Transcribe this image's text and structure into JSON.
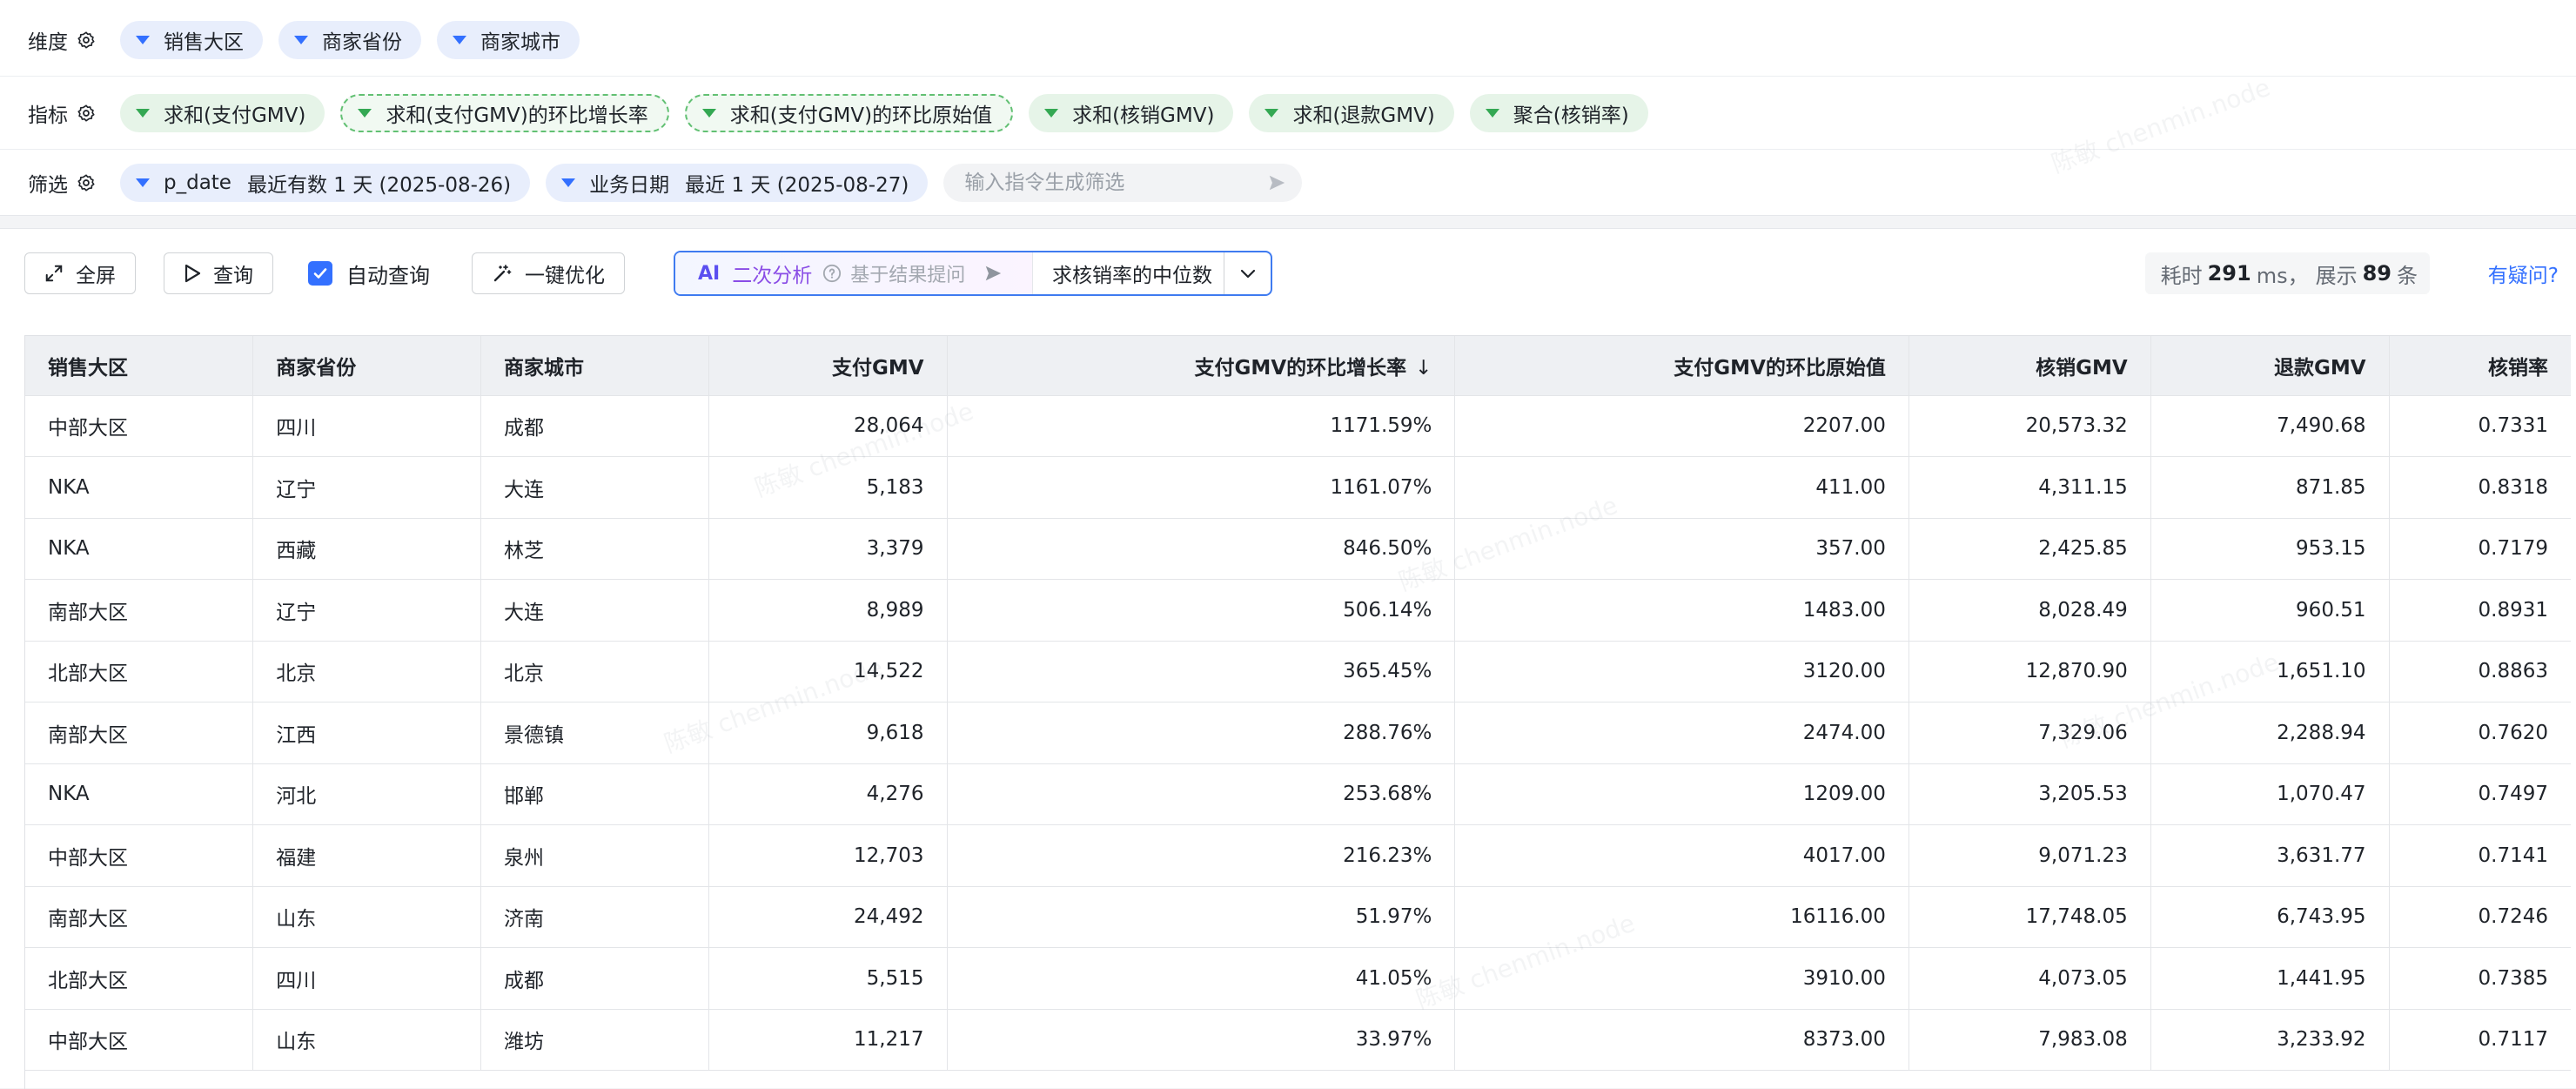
{
  "config": {
    "dimensions": {
      "label": "维度",
      "chips": [
        "销售大区",
        "商家省份",
        "商家城市"
      ]
    },
    "metrics": {
      "label": "指标",
      "chips": [
        {
          "label": "求和(支付GMV)",
          "dashed": false
        },
        {
          "label": "求和(支付GMV)的环比增长率",
          "dashed": true
        },
        {
          "label": "求和(支付GMV)的环比原始值",
          "dashed": true
        },
        {
          "label": "求和(核销GMV)",
          "dashed": false
        },
        {
          "label": "求和(退款GMV)",
          "dashed": false
        },
        {
          "label": "聚合(核销率)",
          "dashed": false
        }
      ]
    },
    "filters": {
      "label": "筛选",
      "chips": [
        {
          "field": "p_date",
          "value": "最近有数 1 天 (2025-08-26)"
        },
        {
          "field": "业务日期",
          "value": "最近 1 天 (2025-08-27)"
        }
      ],
      "command_placeholder": "输入指令生成筛选"
    }
  },
  "toolbar": {
    "fullscreen_label": "全屏",
    "query_label": "查询",
    "auto_query_label": "自动查询",
    "auto_query_checked": true,
    "optimize_label": "一键优化",
    "ai": {
      "tag": "AI",
      "title": "二次分析",
      "hint": "基于结果提问",
      "prompt": "求核销率的中位数"
    },
    "stats": {
      "time_prefix": "耗时",
      "time_value": "291",
      "time_unit": "ms，",
      "count_prefix": "展示",
      "count_value": "89",
      "count_unit": "条"
    },
    "help_label": "有疑问?"
  },
  "table": {
    "columns": [
      {
        "label": "销售大区",
        "align": "l"
      },
      {
        "label": "商家省份",
        "align": "l"
      },
      {
        "label": "商家城市",
        "align": "l"
      },
      {
        "label": "支付GMV",
        "align": "r"
      },
      {
        "label": "支付GMV的环比增长率",
        "align": "r",
        "sort": "↓"
      },
      {
        "label": "支付GMV的环比原始值",
        "align": "r"
      },
      {
        "label": "核销GMV",
        "align": "r"
      },
      {
        "label": "退款GMV",
        "align": "r"
      },
      {
        "label": "核销率",
        "align": "r"
      }
    ],
    "rows": [
      [
        "中部大区",
        "四川",
        "成都",
        "28,064",
        "1171.59%",
        "2207.00",
        "20,573.32",
        "7,490.68",
        "0.7331"
      ],
      [
        "NKA",
        "辽宁",
        "大连",
        "5,183",
        "1161.07%",
        "411.00",
        "4,311.15",
        "871.85",
        "0.8318"
      ],
      [
        "NKA",
        "西藏",
        "林芝",
        "3,379",
        "846.50%",
        "357.00",
        "2,425.85",
        "953.15",
        "0.7179"
      ],
      [
        "南部大区",
        "辽宁",
        "大连",
        "8,989",
        "506.14%",
        "1483.00",
        "8,028.49",
        "960.51",
        "0.8931"
      ],
      [
        "北部大区",
        "北京",
        "北京",
        "14,522",
        "365.45%",
        "3120.00",
        "12,870.90",
        "1,651.10",
        "0.8863"
      ],
      [
        "南部大区",
        "江西",
        "景德镇",
        "9,618",
        "288.76%",
        "2474.00",
        "7,329.06",
        "2,288.94",
        "0.7620"
      ],
      [
        "NKA",
        "河北",
        "邯郸",
        "4,276",
        "253.68%",
        "1209.00",
        "3,205.53",
        "1,070.47",
        "0.7497"
      ],
      [
        "中部大区",
        "福建",
        "泉州",
        "12,703",
        "216.23%",
        "4017.00",
        "9,071.23",
        "3,631.77",
        "0.7141"
      ],
      [
        "南部大区",
        "山东",
        "济南",
        "24,492",
        "51.97%",
        "16116.00",
        "17,748.05",
        "6,743.95",
        "0.7246"
      ],
      [
        "北部大区",
        "四川",
        "成都",
        "5,515",
        "41.05%",
        "3910.00",
        "4,073.05",
        "1,441.95",
        "0.7385"
      ],
      [
        "中部大区",
        "山东",
        "潍坊",
        "11,217",
        "33.97%",
        "8373.00",
        "7,983.08",
        "3,233.92",
        "0.7117"
      ]
    ]
  },
  "watermark_text": "陈敏 chenmin.node"
}
